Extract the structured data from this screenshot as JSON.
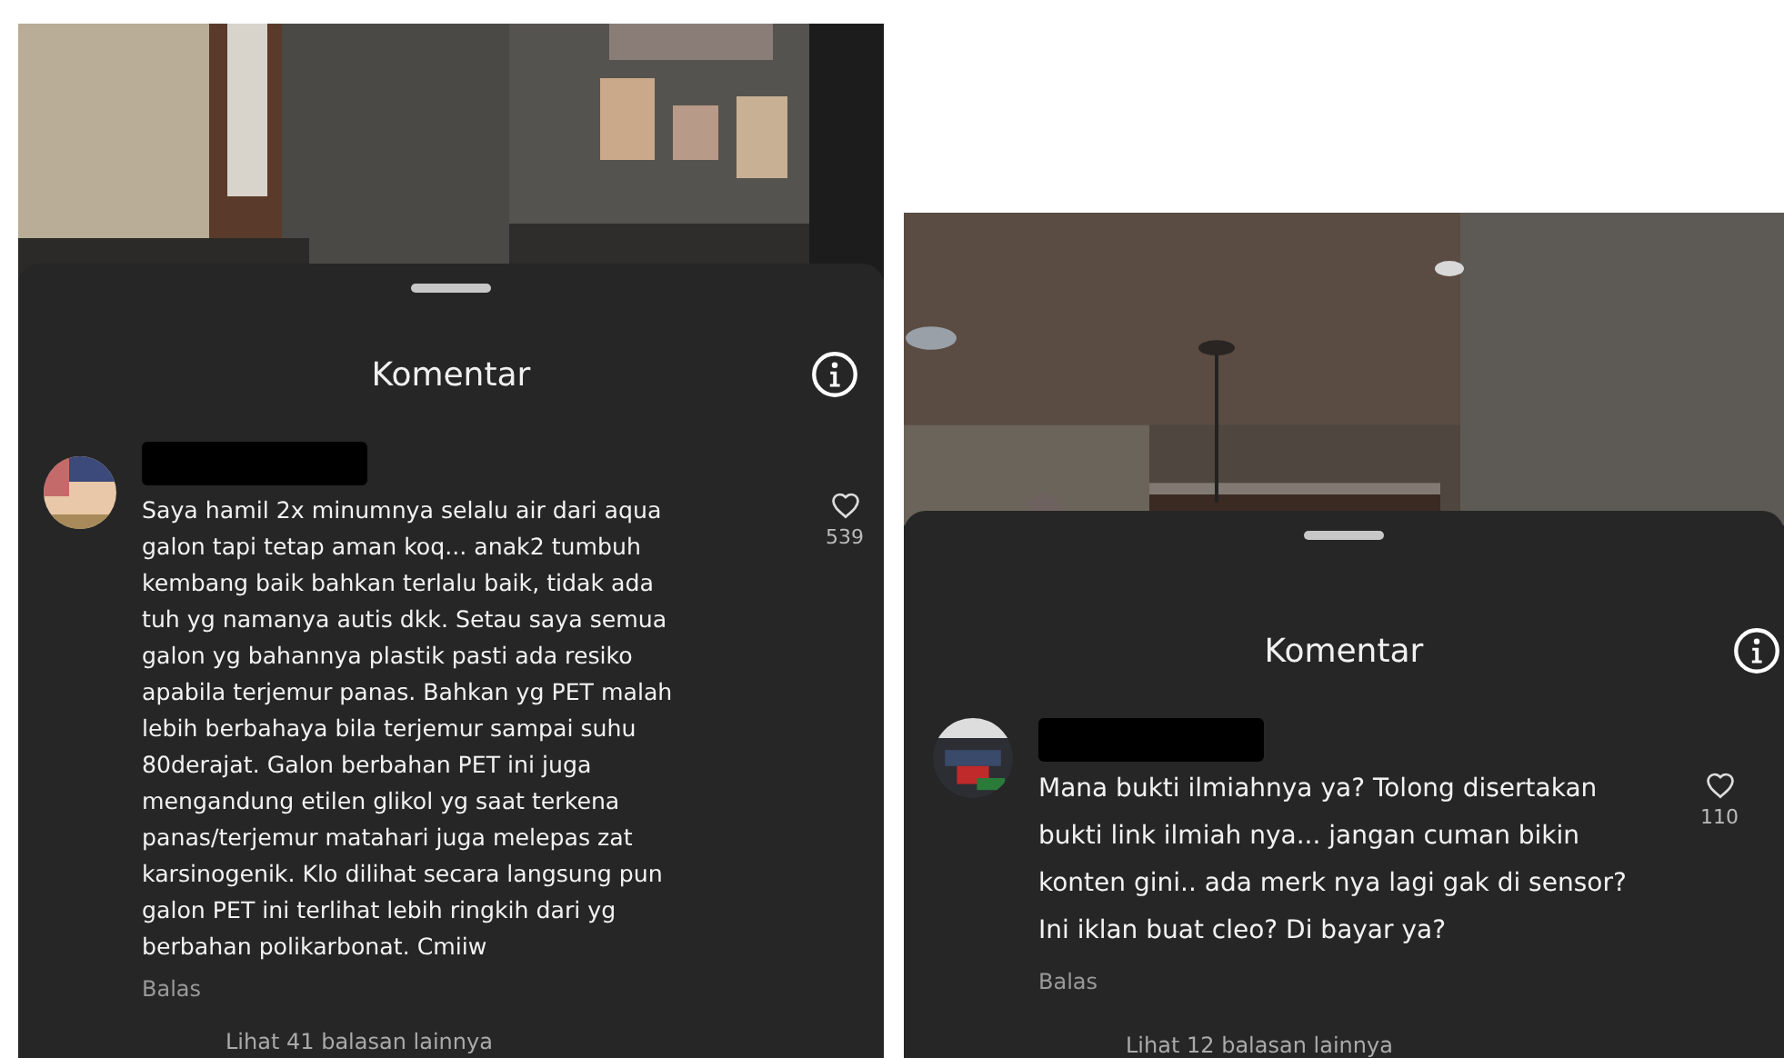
{
  "panels": [
    {
      "title": "Komentar",
      "comments": [
        {
          "text": "Saya hamil 2x minumnya selalu air dari aqua\ngalon tapi tetap aman koq... anak2 tumbuh\nkembang baik bahkan terlalu baik, tidak ada\ntuh yg namanya autis dkk. Setau saya semua\ngalon yg bahannya plastik pasti ada resiko\napabila terjemur panas. Bahkan yg PET malah\nlebih berbahaya bila terjemur sampai suhu\n80derajat. Galon berbahan PET ini juga\nmengandung etilen glikol yg saat terkena\npanas/terjemur matahari juga melepas zat\nkarsinogenik. Klo dilihat secara langsung pun\ngalon PET ini terlihat lebih ringkih dari yg\nberbahan polikarbonat. Cmiiw",
          "likes": "539",
          "reply": "Balas",
          "more_replies": "Lihat 41 balasan lainnya"
        }
      ]
    },
    {
      "title": "Komentar",
      "comments": [
        {
          "text": "Mana bukti ilmiahnya ya? Tolong disertakan\nbukti link ilmiah nya... jangan cuman bikin\nkonten gini.. ada merk nya lagi gak di sensor?\nIni iklan buat cleo? Di bayar ya?",
          "likes": "110",
          "reply": "Balas",
          "more_replies": "Lihat 12 balasan lainnya"
        }
      ]
    }
  ]
}
